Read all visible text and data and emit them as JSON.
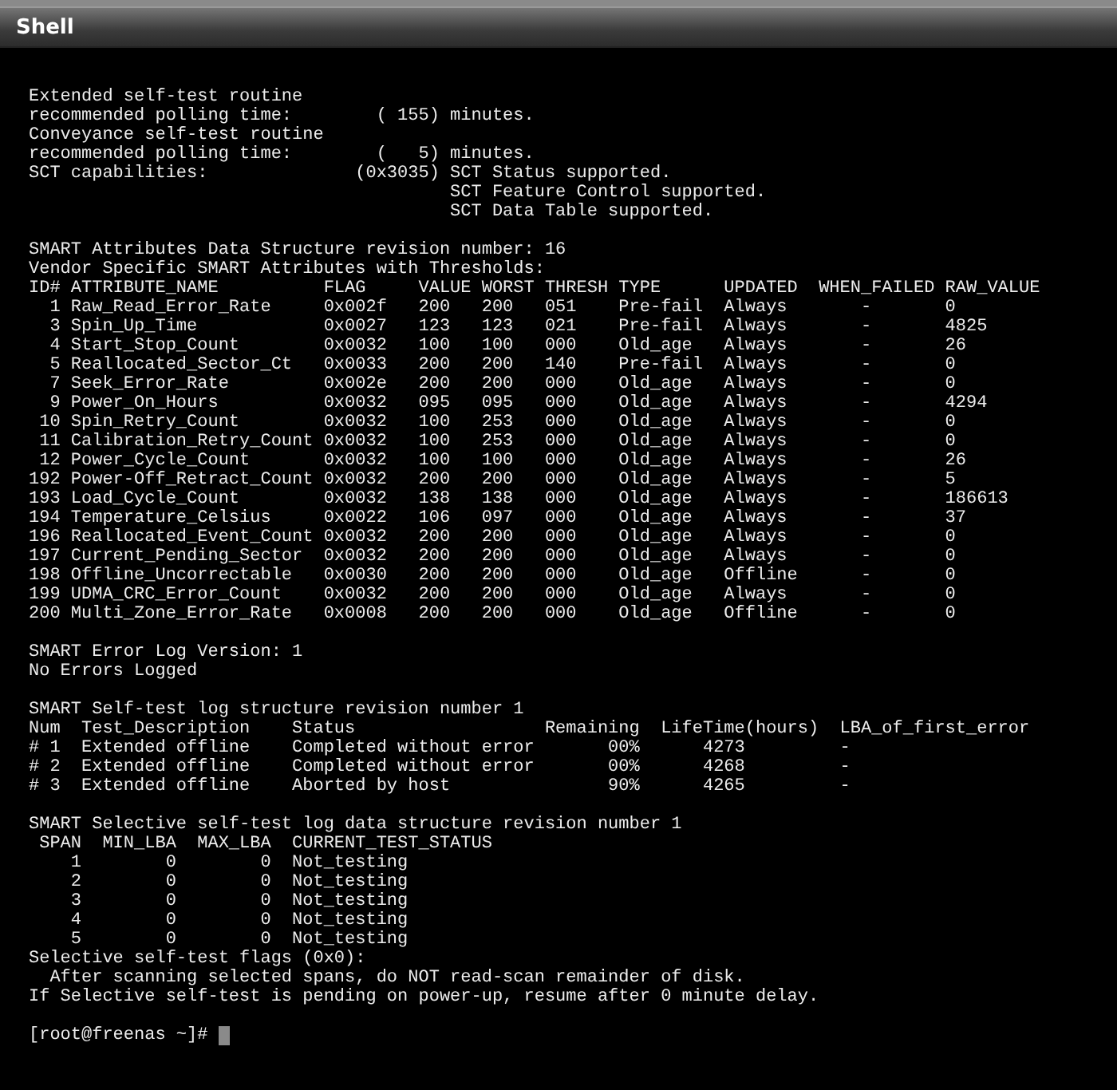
{
  "window": {
    "title": "Shell"
  },
  "terminal": {
    "blocks": [
      {
        "lines": [
          "Extended self-test routine",
          "recommended polling time:        ( 155) minutes.",
          "Conveyance self-test routine",
          "recommended polling time:        (   5) minutes.",
          "SCT capabilities:              (0x3035) SCT Status supported.",
          "                                        SCT Feature Control supported.",
          "                                        SCT Data Table supported."
        ]
      },
      {
        "lines": [
          "SMART Attributes Data Structure revision number: 16",
          "Vendor Specific SMART Attributes with Thresholds:",
          "ID# ATTRIBUTE_NAME          FLAG     VALUE WORST THRESH TYPE      UPDATED  WHEN_FAILED RAW_VALUE",
          "  1 Raw_Read_Error_Rate     0x002f   200   200   051    Pre-fail  Always       -       0",
          "  3 Spin_Up_Time            0x0027   123   123   021    Pre-fail  Always       -       4825",
          "  4 Start_Stop_Count        0x0032   100   100   000    Old_age   Always       -       26",
          "  5 Reallocated_Sector_Ct   0x0033   200   200   140    Pre-fail  Always       -       0",
          "  7 Seek_Error_Rate         0x002e   200   200   000    Old_age   Always       -       0",
          "  9 Power_On_Hours          0x0032   095   095   000    Old_age   Always       -       4294",
          " 10 Spin_Retry_Count        0x0032   100   253   000    Old_age   Always       -       0",
          " 11 Calibration_Retry_Count 0x0032   100   253   000    Old_age   Always       -       0",
          " 12 Power_Cycle_Count       0x0032   100   100   000    Old_age   Always       -       26",
          "192 Power-Off_Retract_Count 0x0032   200   200   000    Old_age   Always       -       5",
          "193 Load_Cycle_Count        0x0032   138   138   000    Old_age   Always       -       186613",
          "194 Temperature_Celsius     0x0022   106   097   000    Old_age   Always       -       37",
          "196 Reallocated_Event_Count 0x0032   200   200   000    Old_age   Always       -       0",
          "197 Current_Pending_Sector  0x0032   200   200   000    Old_age   Always       -       0",
          "198 Offline_Uncorrectable   0x0030   200   200   000    Old_age   Offline      -       0",
          "199 UDMA_CRC_Error_Count    0x0032   200   200   000    Old_age   Always       -       0",
          "200 Multi_Zone_Error_Rate   0x0008   200   200   000    Old_age   Offline      -       0"
        ]
      },
      {
        "lines": [
          "SMART Error Log Version: 1",
          "No Errors Logged"
        ]
      },
      {
        "lines": [
          "SMART Self-test log structure revision number 1",
          "Num  Test_Description    Status                  Remaining  LifeTime(hours)  LBA_of_first_error",
          "# 1  Extended offline    Completed without error       00%      4273         -",
          "# 2  Extended offline    Completed without error       00%      4268         -",
          "# 3  Extended offline    Aborted by host               90%      4265         -"
        ]
      },
      {
        "lines": [
          "SMART Selective self-test log data structure revision number 1",
          " SPAN  MIN_LBA  MAX_LBA  CURRENT_TEST_STATUS",
          "    1        0        0  Not_testing",
          "    2        0        0  Not_testing",
          "    3        0        0  Not_testing",
          "    4        0        0  Not_testing",
          "    5        0        0  Not_testing",
          "Selective self-test flags (0x0):",
          "  After scanning selected spans, do NOT read-scan remainder of disk.",
          "If Selective self-test is pending on power-up, resume after 0 minute delay."
        ]
      }
    ],
    "prompt": "[root@freenas ~]#"
  }
}
